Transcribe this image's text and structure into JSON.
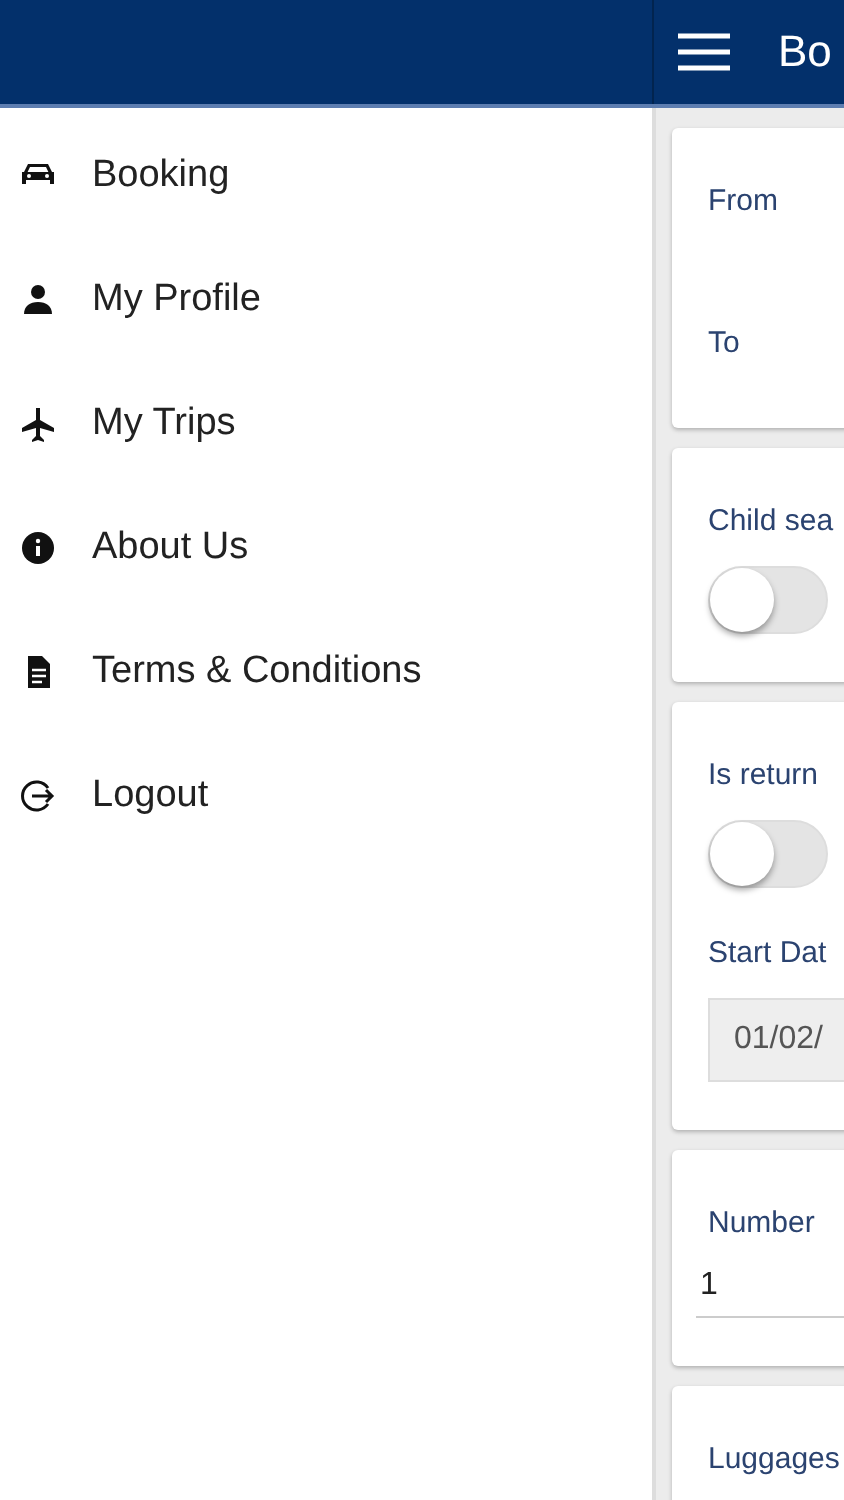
{
  "header": {
    "title": "Bo"
  },
  "drawer": {
    "items": [
      {
        "label": "Booking"
      },
      {
        "label": "My Profile"
      },
      {
        "label": "My Trips"
      },
      {
        "label": "About Us"
      },
      {
        "label": "Terms & Conditions"
      },
      {
        "label": "Logout"
      }
    ]
  },
  "form": {
    "cards": [
      {
        "fields": [
          {
            "kind": "label",
            "label": "From"
          },
          {
            "kind": "label",
            "label": "To"
          }
        ]
      },
      {
        "fields": [
          {
            "kind": "toggle",
            "label": "Child sea",
            "on": false
          }
        ]
      },
      {
        "fields": [
          {
            "kind": "toggle",
            "label": "Is return",
            "on": false
          },
          {
            "kind": "date",
            "label": "Start Dat",
            "value": "01/02/"
          }
        ]
      },
      {
        "fields": [
          {
            "kind": "number",
            "label": "Number",
            "value": "1"
          }
        ]
      },
      {
        "fields": [
          {
            "kind": "label",
            "label": "Luggages"
          }
        ]
      }
    ]
  }
}
